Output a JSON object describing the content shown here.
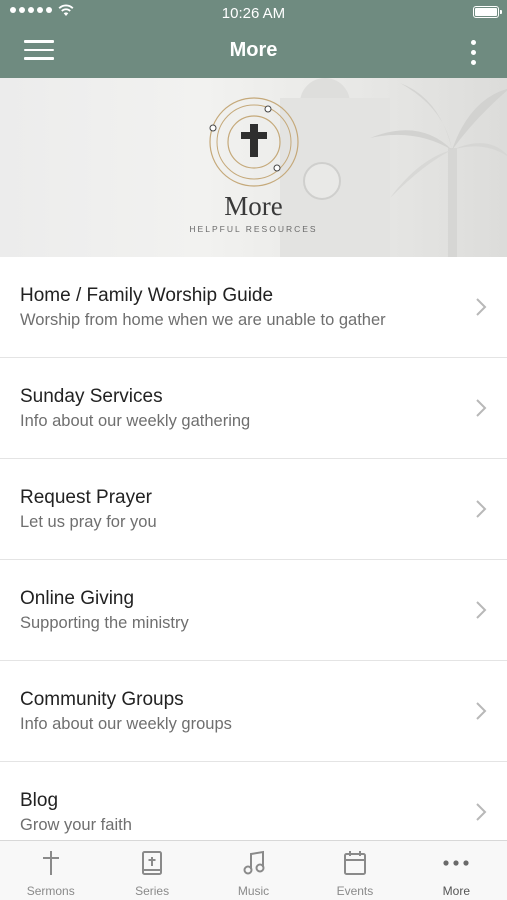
{
  "status_bar": {
    "time": "10:26 AM"
  },
  "header": {
    "title": "More"
  },
  "banner": {
    "logo_word": "More",
    "logo_subtitle": "HELPFUL RESOURCES"
  },
  "items": [
    {
      "title": "Home / Family Worship Guide",
      "subtitle": "Worship from home when we are unable to gather"
    },
    {
      "title": "Sunday Services",
      "subtitle": "Info about our weekly gathering"
    },
    {
      "title": "Request Prayer",
      "subtitle": "Let us pray for you"
    },
    {
      "title": "Online Giving",
      "subtitle": "Supporting the ministry"
    },
    {
      "title": "Community Groups",
      "subtitle": "Info about our weekly groups"
    },
    {
      "title": "Blog",
      "subtitle": "Grow your faith"
    }
  ],
  "tabs": [
    {
      "label": "Sermons",
      "icon": "cross-icon"
    },
    {
      "label": "Series",
      "icon": "bible-icon"
    },
    {
      "label": "Music",
      "icon": "music-note-icon"
    },
    {
      "label": "Events",
      "icon": "calendar-icon"
    },
    {
      "label": "More",
      "icon": "more-dots-icon",
      "active": true
    }
  ],
  "colors": {
    "header_bg": "#6f8b80",
    "tab_icon": "#8a8a8a"
  }
}
